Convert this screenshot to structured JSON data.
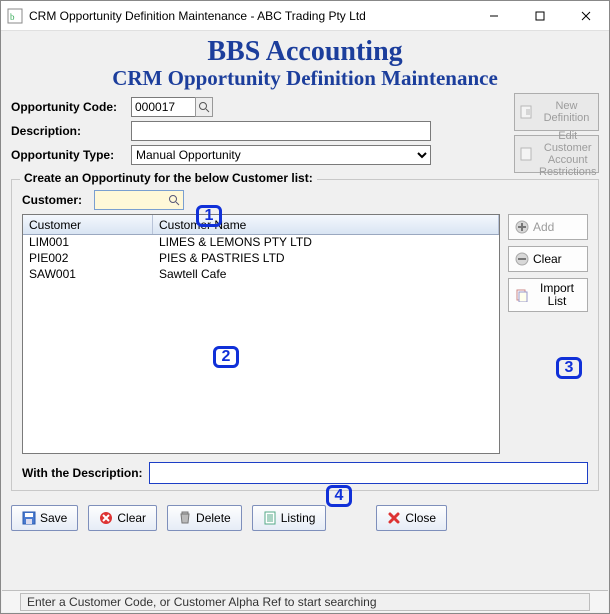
{
  "window": {
    "title": "CRM Opportunity Definition Maintenance - ABC Trading Pty Ltd"
  },
  "header": {
    "title1": "BBS Accounting",
    "title2": "CRM Opportunity Definition Maintenance"
  },
  "form": {
    "opportunity_code_label": "Opportunity Code:",
    "opportunity_code_value": "000017",
    "description_label": "Description:",
    "description_value": "",
    "opportunity_type_label": "Opportunity Type:",
    "opportunity_type_value": "Manual Opportunity"
  },
  "side_buttons": {
    "new_definition": "New Definition",
    "edit_restrictions": "Edit Customer Account Restrictions"
  },
  "group": {
    "title": "Create an Opportinuty for the below Customer list:",
    "customer_label": "Customer:",
    "customer_value": "",
    "col1": "Customer",
    "col2": "Customer Name",
    "rows": [
      {
        "code": "LIM001",
        "name": "LIMES & LEMONS PTY LTD"
      },
      {
        "code": "PIE002",
        "name": "PIES & PASTRIES LTD"
      },
      {
        "code": "SAW001",
        "name": "Sawtell Cafe"
      }
    ],
    "add_btn": "Add",
    "clear_btn": "Clear",
    "import_btn": "Import List",
    "with_desc_label": "With the Description:",
    "with_desc_value": ""
  },
  "toolbar": {
    "save": "Save",
    "clear": "Clear",
    "delete": "Delete",
    "listing": "Listing",
    "close": "Close"
  },
  "status": {
    "message": "Enter a Customer Code, or Customer Alpha Ref to start searching"
  },
  "callouts": {
    "c1": "1",
    "c2": "2",
    "c3": "3",
    "c4": "4"
  }
}
